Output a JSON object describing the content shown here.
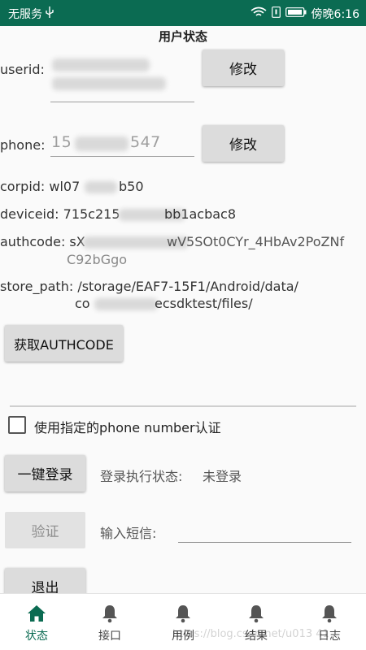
{
  "status_bar": {
    "carrier": "无服务",
    "usb_icon": "usb-icon",
    "wifi_icon": "wifi-icon",
    "sim_icon": "sim-icon",
    "battery_icon": "battery-icon",
    "time": "傍晚6:16"
  },
  "page_title": "用户状态",
  "userid": {
    "label": "userid:",
    "edit_button": "修改"
  },
  "phone": {
    "label": "phone:",
    "value_start": "15",
    "value_end": "547",
    "edit_button": "修改"
  },
  "corpid": {
    "start": "corpid: wl07",
    "end": "b50"
  },
  "deviceid": {
    "start": "deviceid: 715c215",
    "end": "bb1acbac8"
  },
  "authcode": {
    "start": "authcode: sX",
    "end": "wV5SOt0CYr_4HbAv2PoZNf",
    "line2": "C92bGgo"
  },
  "store_path": {
    "line1": "store_path: /storage/EAF7-15F1/Android/data/",
    "line2_start": "co",
    "line2_end": "ecsdktest/files/"
  },
  "get_authcode_button": "获取AUTHCODE",
  "use_phone_checkbox": {
    "label": "使用指定的phone number认证",
    "checked": false
  },
  "login": {
    "button": "一键登录",
    "state_label": "登录执行状态:",
    "state_value": "未登录"
  },
  "verify": {
    "button": "验证",
    "sms_label": "输入短信:"
  },
  "logout_button": "退出",
  "bottom_nav": [
    {
      "label": "状态",
      "icon": "home-icon",
      "active": true
    },
    {
      "label": "接口",
      "icon": "bell-icon",
      "active": false
    },
    {
      "label": "用例",
      "icon": "bell-icon",
      "active": false
    },
    {
      "label": "结果",
      "icon": "bell-icon",
      "active": false
    },
    {
      "label": "日志",
      "icon": "bell-icon",
      "active": false
    }
  ],
  "watermark": "https://blog.csdn.net/u013 41",
  "colors": {
    "status_bar": "#0b6b52",
    "accent": "#0b6b52",
    "button": "#dcdcdc"
  }
}
